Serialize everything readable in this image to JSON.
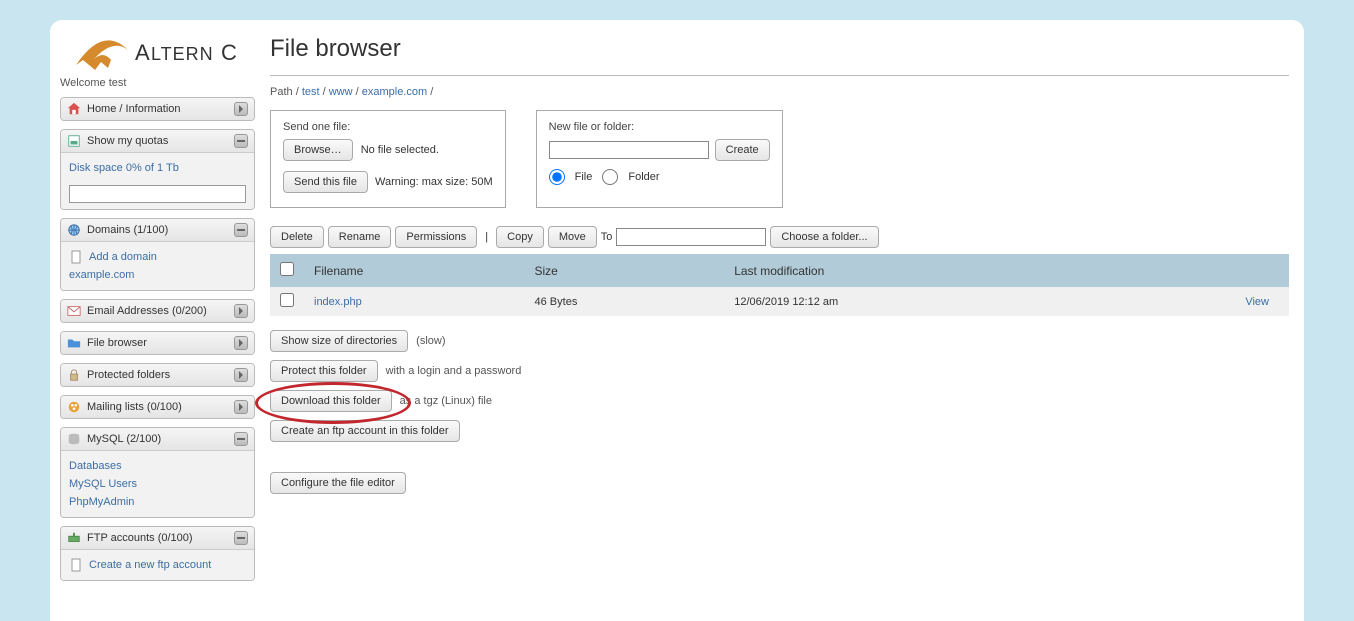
{
  "welcome": "Welcome test",
  "logo_text": "AlternC",
  "sidebar": {
    "home": "Home / Information",
    "quotas": "Show my quotas",
    "disk_space": "Disk space 0% of 1 Tb",
    "domains": "Domains (1/100)",
    "add_domain": "Add a domain",
    "domain_example": "example.com",
    "email": "Email Addresses (0/200)",
    "filebrowser": "File browser",
    "protected": "Protected folders",
    "mailing": "Mailing lists (0/100)",
    "mysql": "MySQL (2/100)",
    "databases": "Databases",
    "mysql_users": "MySQL Users",
    "phpmyadmin": "PhpMyAdmin",
    "ftp": "FTP accounts (0/100)",
    "create_ftp": "Create a new ftp account"
  },
  "title": "File browser",
  "path": {
    "label": "Path",
    "parts": [
      "test",
      "www",
      "example.com"
    ]
  },
  "upload": {
    "label": "Send one file:",
    "browse": "Browse…",
    "no_file": "No file selected.",
    "send": "Send this file",
    "warning": "Warning: max size: 50M"
  },
  "newfile": {
    "label": "New file or folder:",
    "create": "Create",
    "file": "File",
    "folder": "Folder"
  },
  "actions": {
    "delete": "Delete",
    "rename": "Rename",
    "permissions": "Permissions",
    "copy": "Copy",
    "move": "Move",
    "to": "To",
    "choose": "Choose a folder..."
  },
  "table": {
    "headers": {
      "filename": "Filename",
      "size": "Size",
      "modified": "Last modification"
    },
    "rows": [
      {
        "name": "index.php",
        "size": "46 Bytes",
        "modified": "12/06/2019 12:12 am",
        "view": "View"
      }
    ]
  },
  "folder_actions": {
    "show_size": "Show size of directories",
    "show_size_note": "(slow)",
    "protect": "Protect this folder",
    "protect_note": "with a login and a password",
    "download": "Download this folder",
    "download_note": "as a tgz (Linux) file",
    "create_ftp": "Create an ftp account in this folder",
    "configure": "Configure the file editor"
  }
}
